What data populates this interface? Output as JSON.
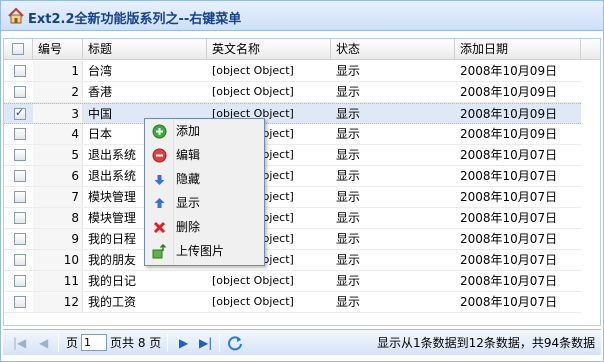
{
  "window": {
    "title": "Ext2.2全新功能版系列之--右键菜单"
  },
  "grid": {
    "columns": [
      "编号",
      "标题",
      "英文名称",
      "状态",
      "添加日期"
    ],
    "rows": [
      {
        "id": "1",
        "title": "台湾",
        "en": "[object Object]",
        "status": "显示",
        "date": "2008年10月09日",
        "checked": false
      },
      {
        "id": "2",
        "title": "香港",
        "en": "[object Object]",
        "status": "显示",
        "date": "2008年10月09日",
        "checked": false
      },
      {
        "id": "3",
        "title": "中国",
        "en": "[object Object]",
        "status": "显示",
        "date": "2008年10月09日",
        "checked": true
      },
      {
        "id": "4",
        "title": "日本",
        "en": "[object Object]",
        "status": "显示",
        "date": "2008年10月09日",
        "checked": false
      },
      {
        "id": "5",
        "title": "退出系统",
        "en": "[object Object]",
        "status": "显示",
        "date": "2008年10月07日",
        "checked": false
      },
      {
        "id": "6",
        "title": "退出系统",
        "en": "[object Object]",
        "status": "显示",
        "date": "2008年10月07日",
        "checked": false
      },
      {
        "id": "7",
        "title": "模块管理",
        "en": "[object Object]",
        "status": "显示",
        "date": "2008年10月07日",
        "checked": false
      },
      {
        "id": "8",
        "title": "模块管理",
        "en": "[object Object]",
        "status": "显示",
        "date": "2008年10月07日",
        "checked": false
      },
      {
        "id": "9",
        "title": "我的日程",
        "en": "[object Object]",
        "status": "显示",
        "date": "2008年10月07日",
        "checked": false
      },
      {
        "id": "10",
        "title": "我的朋友",
        "en": "[object Object]",
        "status": "显示",
        "date": "2008年10月07日",
        "checked": false
      },
      {
        "id": "11",
        "title": "我的日记",
        "en": "[object Object]",
        "status": "显示",
        "date": "2008年10月07日",
        "checked": false
      },
      {
        "id": "12",
        "title": "我的工资",
        "en": "[object Object]",
        "status": "显示",
        "date": "2008年10月07日",
        "checked": false
      }
    ]
  },
  "context_menu": {
    "items": [
      {
        "label": "添加",
        "icon": "add-icon"
      },
      {
        "label": "编辑",
        "icon": "edit-icon"
      },
      {
        "label": "隐藏",
        "icon": "hide-icon"
      },
      {
        "label": "显示",
        "icon": "show-icon"
      },
      {
        "label": "删除",
        "icon": "delete-icon"
      },
      {
        "label": "上传图片",
        "icon": "upload-image-icon"
      }
    ]
  },
  "pager": {
    "page_label": "页",
    "page_value": "1",
    "total_label": "页共 8 页",
    "display_msg": "显示从1条数据到12条数据，共94条数据"
  },
  "colors": {
    "title_text": "#15428b",
    "selected_row": "#dfe8f6",
    "border": "#99bbe8"
  }
}
